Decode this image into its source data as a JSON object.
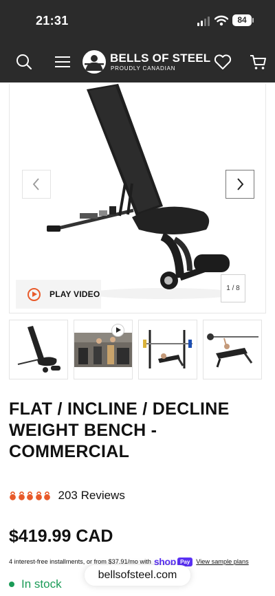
{
  "status_bar": {
    "time": "21:31",
    "battery": "84"
  },
  "header": {
    "brand": "BELLS OF STEEL",
    "tagline": "PROUDLY CANADIAN"
  },
  "gallery": {
    "play_video_label": "PLAY VIDEO",
    "counter": "1 / 8"
  },
  "product": {
    "title_lines": [
      "FLAT / INCLINE / DECLINE",
      "WEIGHT BENCH -",
      "COMMERCIAL"
    ],
    "rating_stars": 5,
    "reviews": "203 Reviews",
    "price": "$419.99 CAD",
    "installments_text": "4 interest-free installments, or from $37.91/mo with",
    "shop_logo": "shop",
    "pay_badge": "Pay",
    "sample_plans_link": "View sample plans",
    "stock_status": "In stock"
  },
  "browser": {
    "url": "bellsofsteel.com"
  },
  "colors": {
    "header_bg": "#2b2b2b",
    "accent": "#e85a2a",
    "shop_pay": "#5a31f4",
    "in_stock": "#1a9b57"
  },
  "icons": [
    "search-icon",
    "menu-icon",
    "heart-icon",
    "cart-icon",
    "chevron-left-icon",
    "chevron-right-icon",
    "play-icon",
    "kettlebell-icon"
  ]
}
